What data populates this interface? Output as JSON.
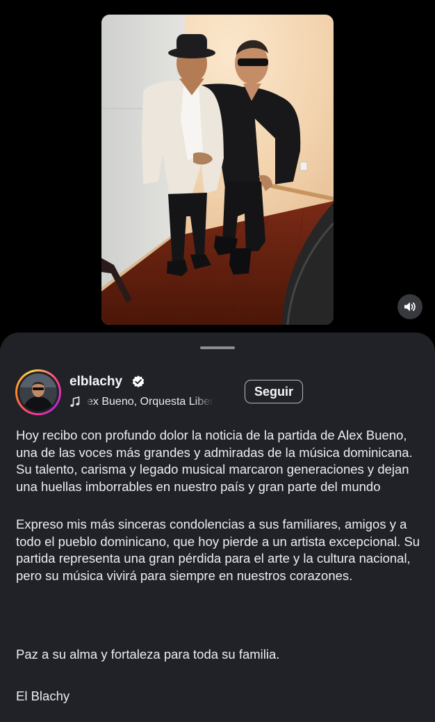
{
  "post": {
    "media": {
      "mute_icon": "speaker-icon"
    },
    "author": {
      "username": "elblachy",
      "verified_icon": "verified-badge-icon",
      "music_icon": "music-note-icon",
      "audio_label": "ex Bueno, Orquesta Liber"
    },
    "follow_label": "Seguir",
    "caption": {
      "paragraph_1": "Hoy recibo con profundo dolor la noticia de la partida de Alex Bueno, una de las voces más grandes y admiradas de la música dominicana. Su talento, carisma y legado musical marcaron generaciones y dejan una huellas imborrables en nuestro país y gran parte del mundo",
      "paragraph_2": "Expreso mis más sinceras condolencias a sus familiares, amigos y a todo el pueblo dominicano, que hoy pierde a un artista excepcional. Su partida representa una gran pérdida para el arte y la cultura nacional, pero su música vivirá para siempre en nuestros corazones.",
      "paragraph_3": "Paz a su alma y fortaleza para toda su familia.",
      "signature": "El Blachy"
    }
  },
  "colors": {
    "background": "#000000",
    "sheet": "#202227",
    "text": "#eceef0",
    "verified": "#ffffff"
  }
}
